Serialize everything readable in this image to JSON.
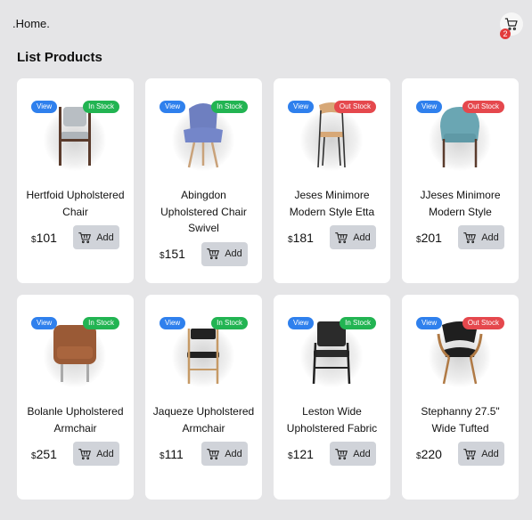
{
  "nav": {
    "home_label": ".Home.",
    "cart_count": "2"
  },
  "page": {
    "title": "List Products"
  },
  "view_label": "View",
  "currency": "$",
  "add_label": "Add",
  "products": [
    {
      "name": "Hertfoid Upholstered Chair",
      "price": "101",
      "stock": "In Stock",
      "in_stock": true,
      "chair": "gray-wood"
    },
    {
      "name": "Abingdon Upholstered Chair Swivel",
      "price": "151",
      "stock": "In Stock",
      "in_stock": true,
      "chair": "blue-wing"
    },
    {
      "name": "Jeses Minimore Modern Style Etta",
      "price": "181",
      "stock": "Out Stock",
      "in_stock": false,
      "chair": "wood-metal"
    },
    {
      "name": "JJeses Minimore Modern Style",
      "price": "201",
      "stock": "Out Stock",
      "in_stock": false,
      "chair": "teal-armchair"
    },
    {
      "name": "Bolanle Upholstered Armchair",
      "price": "251",
      "stock": "In Stock",
      "in_stock": true,
      "chair": "leather-club"
    },
    {
      "name": "Jaqueze Upholstered Armchair",
      "price": "111",
      "stock": "In Stock",
      "in_stock": true,
      "chair": "black-wood"
    },
    {
      "name": "Leston Wide Upholstered Fabric",
      "price": "121",
      "stock": "In Stock",
      "in_stock": true,
      "chair": "black-frame"
    },
    {
      "name": "Stephanny 27.5\" Wide Tufted",
      "price": "220",
      "stock": "Out Stock",
      "in_stock": false,
      "chair": "black-curve"
    }
  ],
  "colors": {
    "in_stock": "#22b452",
    "out_stock": "#e5484d",
    "view": "#2f80ed",
    "add_button": "#d0d3d9",
    "cart_badge": "#e23b3b"
  }
}
